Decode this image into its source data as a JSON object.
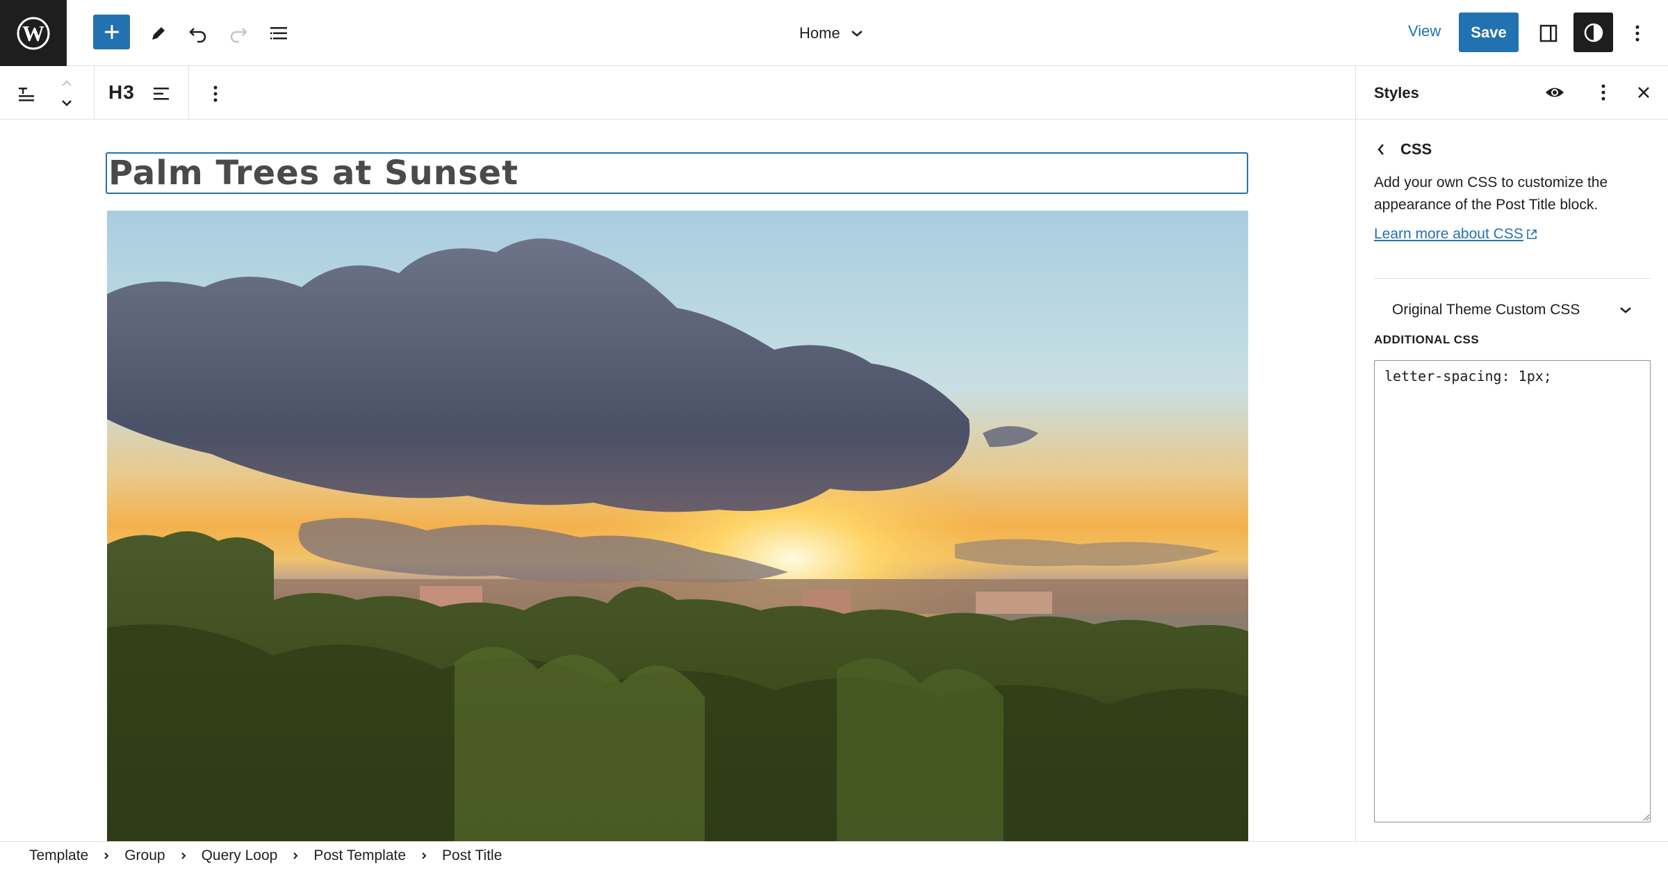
{
  "topbar": {
    "logo_icon": "wordpress-logo-icon",
    "add_icon": "plus-icon",
    "tools": [
      "pencil-icon",
      "undo-icon",
      "redo-icon",
      "list-view-icon"
    ],
    "document_title": "Home",
    "view_label": "View",
    "save_label": "Save",
    "right_icons": [
      "sidebar-toggle-icon",
      "styles-contrast-icon",
      "more-vertical-icon"
    ],
    "accent": "#2271b1"
  },
  "block_toolbar": {
    "heading_level": "H3",
    "icons": [
      "post-title-block-icon",
      "move-up-icon",
      "move-down-icon",
      "align-icon",
      "more-vertical-icon"
    ]
  },
  "canvas": {
    "post_title": "Palm Trees at Sunset"
  },
  "sidebar": {
    "title": "Styles",
    "nav_title": "CSS",
    "description": "Add your own CSS to customize the appearance of the Post Title block.",
    "learn_link": "Learn more about CSS",
    "accordion_label": "Original Theme Custom CSS",
    "additional_css_label": "ADDITIONAL CSS",
    "css_value": "letter-spacing: 1px;"
  },
  "footer": {
    "breadcrumbs": [
      "Template",
      "Group",
      "Query Loop",
      "Post Template",
      "Post Title"
    ]
  }
}
